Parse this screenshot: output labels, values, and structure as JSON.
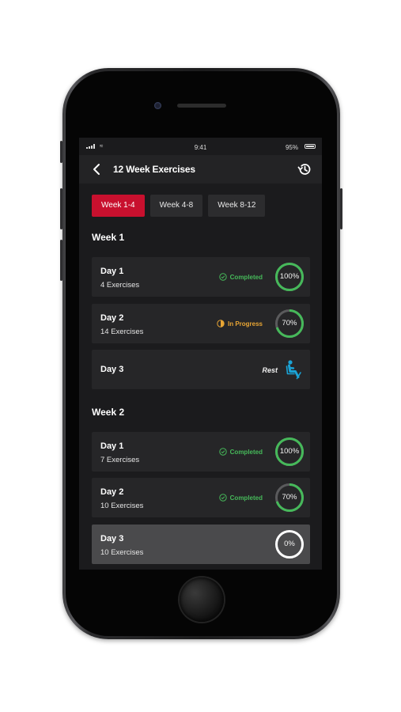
{
  "status_bar": {
    "time": "9:41",
    "battery": "95%"
  },
  "header": {
    "title": "12 Week Exercises"
  },
  "tabs": [
    {
      "label": "Week 1-4",
      "active": true
    },
    {
      "label": "Week 4-8",
      "active": false
    },
    {
      "label": "Week 8-12",
      "active": false
    }
  ],
  "weeks": [
    {
      "title": "Week 1",
      "days": [
        {
          "day": "Day 1",
          "exercises": "4 Exercises",
          "status": "Completed",
          "progress": 100,
          "progress_label": "100%"
        },
        {
          "day": "Day 2",
          "exercises": "14 Exercises",
          "status": "In Progress",
          "progress": 70,
          "progress_label": "70%"
        },
        {
          "day": "Day 3",
          "status": "Rest",
          "icon": "resting-person-icon"
        }
      ]
    },
    {
      "title": "Week 2",
      "days": [
        {
          "day": "Day 1",
          "exercises": "7 Exercises",
          "status": "Completed",
          "progress": 100,
          "progress_label": "100%"
        },
        {
          "day": "Day 2",
          "exercises": "10 Exercises",
          "status": "Completed",
          "progress": 70,
          "progress_label": "70%"
        },
        {
          "day": "Day 3",
          "exercises": "10 Exercises",
          "progress": 0,
          "progress_label": "0%"
        }
      ]
    }
  ],
  "colors": {
    "accent": "#c8102e",
    "completed": "#46b95a",
    "in_progress": "#e8a534",
    "rest_icon": "#1aa3d6",
    "ring_track": "#5a5a5c"
  },
  "icons": [
    "back-arrow-icon",
    "history-icon",
    "check-circle-icon",
    "half-circle-icon",
    "resting-person-icon"
  ]
}
